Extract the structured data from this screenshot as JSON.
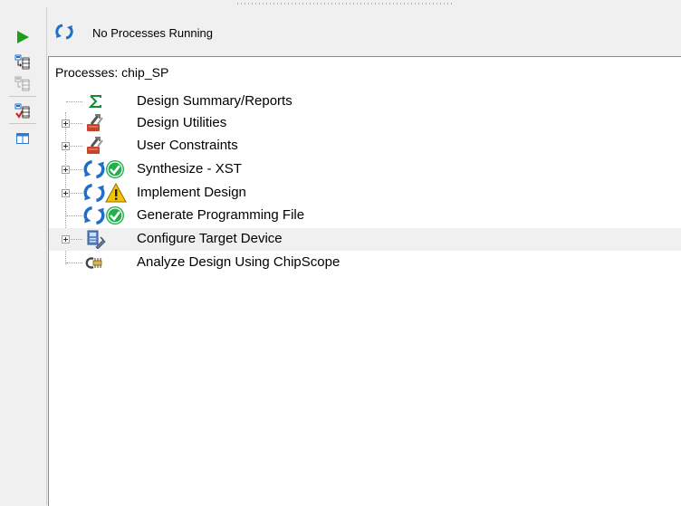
{
  "status": {
    "text": "No Processes Running",
    "icon": "refresh-icon"
  },
  "toolbar": {
    "buttons": [
      {
        "name": "run-button",
        "icon": "play-icon"
      },
      {
        "name": "rerun-button",
        "icon": "rerun-icon"
      },
      {
        "name": "rerun-all-button",
        "icon": "rerun-all-icon"
      },
      {
        "name": "stop-button",
        "icon": "stop-icon"
      },
      {
        "name": "properties-button",
        "icon": "window-icon"
      }
    ]
  },
  "processes": {
    "title": "Processes: chip_SP",
    "items": [
      {
        "label": "Design Summary/Reports",
        "icon": "sigma-icon",
        "expandable": false
      },
      {
        "label": "Design Utilities",
        "icon": "tools-icon",
        "expandable": true
      },
      {
        "label": "User Constraints",
        "icon": "tools-icon",
        "expandable": true
      },
      {
        "label": "Synthesize - XST",
        "icon": "refresh-check-icon",
        "expandable": true
      },
      {
        "label": "Implement Design",
        "icon": "refresh-warning-icon",
        "expandable": true
      },
      {
        "label": "Generate Programming File",
        "icon": "refresh-check-icon",
        "expandable": false
      },
      {
        "label": "Configure Target Device",
        "icon": "configure-device-icon",
        "expandable": true,
        "selected": true
      },
      {
        "label": "Analyze Design Using ChipScope",
        "icon": "chipscope-icon",
        "expandable": false
      }
    ]
  },
  "colors": {
    "play": "#1aa01a",
    "refresh": "#1f6fc9",
    "check": "#22b04a",
    "warning": "#f5c400",
    "sigma": "#138a3b",
    "selected_row": "#f0f0f0"
  }
}
